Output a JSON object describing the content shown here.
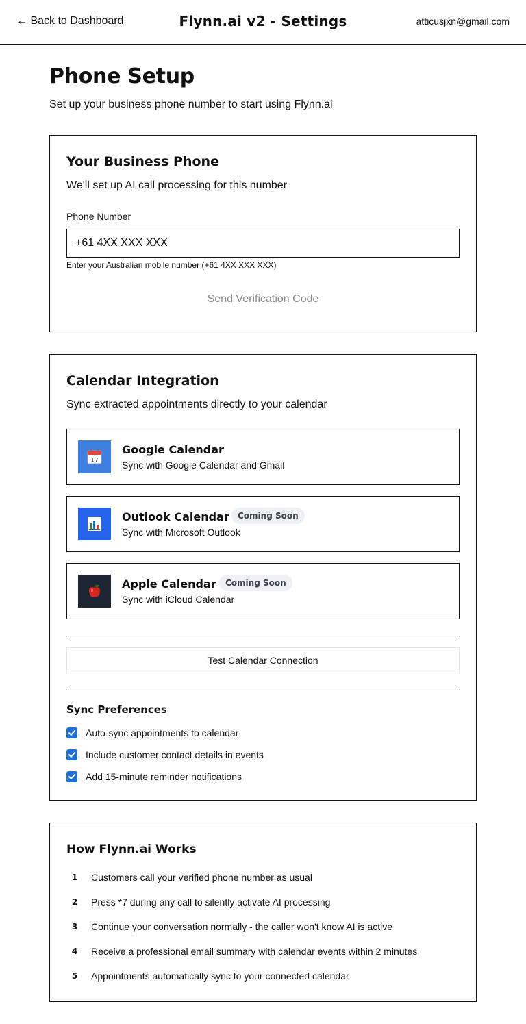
{
  "header": {
    "back_label": "← Back to Dashboard",
    "app_title": "Flynn.ai v2 - Settings",
    "user_email": "atticusjxn@gmail.com"
  },
  "page": {
    "title": "Phone Setup",
    "subtitle": "Set up your business phone number to start using Flynn.ai"
  },
  "phone_card": {
    "title": "Your Business Phone",
    "description": "We'll set up AI call processing for this number",
    "field_label": "Phone Number",
    "phone_placeholder": "+61 4XX XXX XXX",
    "phone_value": "",
    "help_text": "Enter your Australian mobile number (+61 4XX XXX XXX)",
    "send_button": "Send Verification Code"
  },
  "calendar_card": {
    "title": "Calendar Integration",
    "description": "Sync extracted appointments directly to your calendar",
    "providers": [
      {
        "name": "Google Calendar",
        "description": "Sync with Google Calendar and Gmail",
        "badge": "",
        "icon": "google-calendar-icon",
        "icon_bg": "#3f7fe0"
      },
      {
        "name": "Outlook Calendar",
        "description": "Sync with Microsoft Outlook",
        "badge": "Coming Soon",
        "icon": "outlook-calendar-icon",
        "icon_bg": "#2563eb"
      },
      {
        "name": "Apple Calendar",
        "description": "Sync with iCloud Calendar",
        "badge": "Coming Soon",
        "icon": "apple-calendar-icon",
        "icon_bg": "#1f2633"
      }
    ],
    "test_button": "Test Calendar Connection",
    "prefs_title": "Sync Preferences",
    "preferences": [
      {
        "label": "Auto-sync appointments to calendar",
        "checked": true
      },
      {
        "label": "Include customer contact details in events",
        "checked": true
      },
      {
        "label": "Add 15-minute reminder notifications",
        "checked": true
      }
    ]
  },
  "how_card": {
    "title": "How Flynn.ai Works",
    "steps": [
      {
        "num": "1",
        "text": "Customers call your verified phone number as usual"
      },
      {
        "num": "2",
        "text": "Press *7 during any call to silently activate AI processing"
      },
      {
        "num": "3",
        "text": "Continue your conversation normally - the caller won't know AI is active"
      },
      {
        "num": "4",
        "text": "Receive a professional email summary with calendar events within 2 minutes"
      },
      {
        "num": "5",
        "text": "Appointments automatically sync to your connected calendar"
      }
    ]
  },
  "colors": {
    "checkbox": "#1a6fd9",
    "badge_bg": "#eef0f3",
    "badge_text": "#3b4252",
    "disabled_text": "#8a8a8a"
  }
}
